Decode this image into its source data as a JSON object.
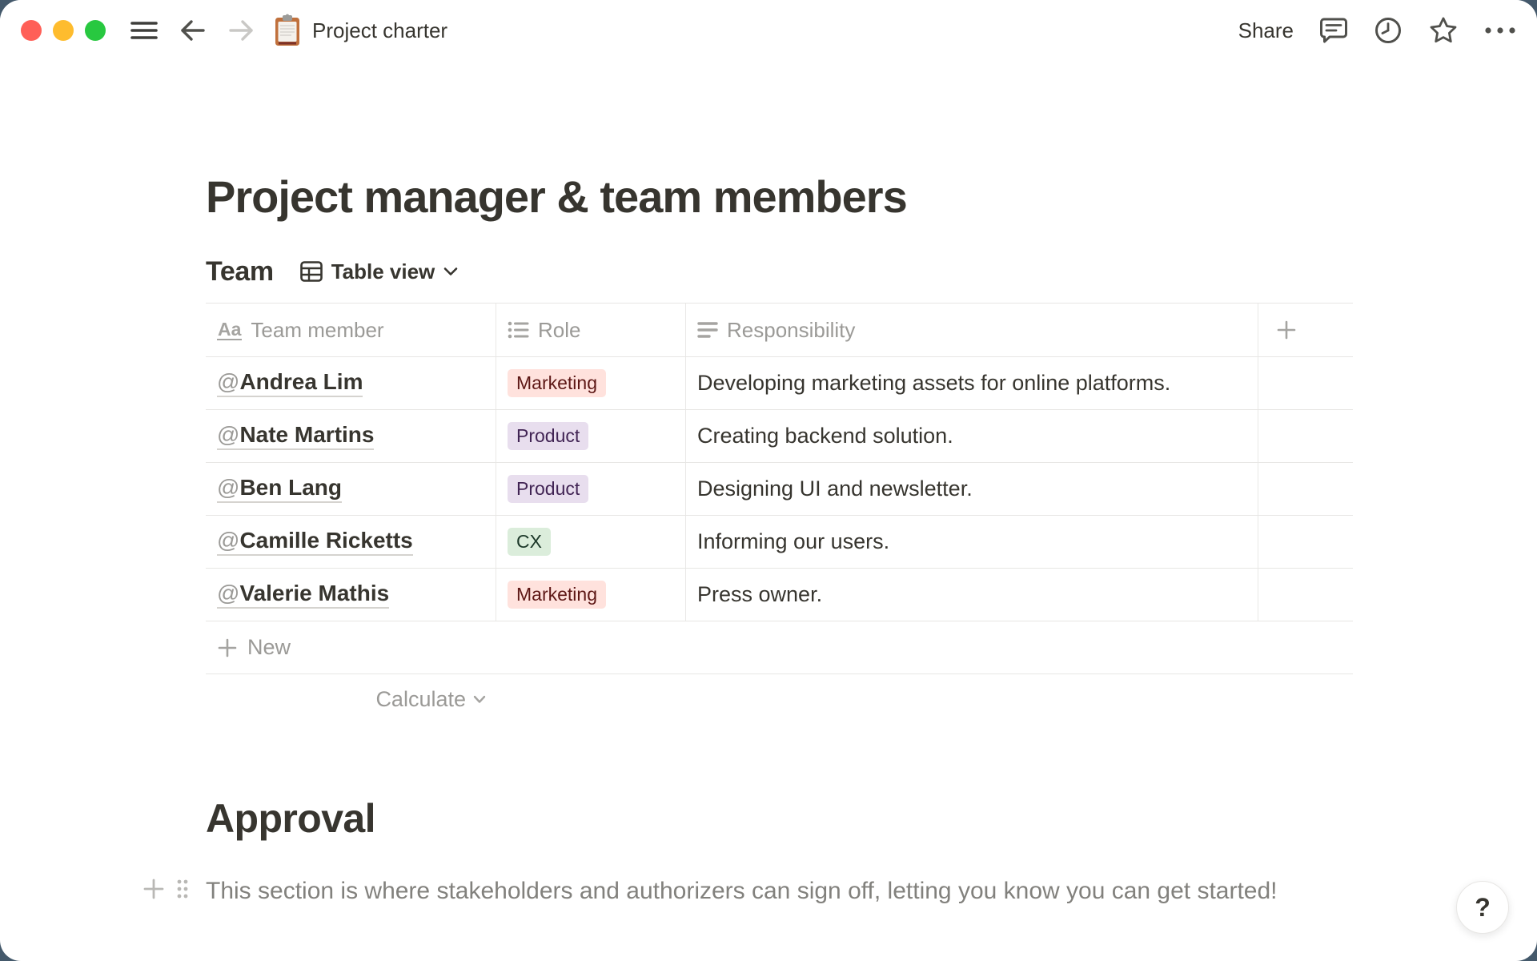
{
  "window": {
    "backdrop_color": "#44596B"
  },
  "topbar": {
    "traffic_lights": {
      "close": "#FF5F57",
      "minimize": "#FEBC2E",
      "zoom": "#28C840"
    },
    "doc_icon": "clipboard",
    "doc_title": "Project charter",
    "share_label": "Share"
  },
  "page": {
    "title": "Project manager & team members",
    "team": {
      "heading": "Team",
      "view_label": "Table view",
      "table": {
        "columns": [
          {
            "label": "Team member",
            "icon": "title-property"
          },
          {
            "label": "Role",
            "icon": "select-property"
          },
          {
            "label": "Responsibility",
            "icon": "text-property"
          }
        ],
        "rows": [
          {
            "member_at": "@",
            "member_name": "Andrea Lim",
            "role": "Marketing",
            "role_bg": "#FFE2DD",
            "role_fg": "#5D1715",
            "responsibility": "Developing marketing assets for online platforms."
          },
          {
            "member_at": "@",
            "member_name": "Nate Martins",
            "role": "Product",
            "role_bg": "#E8DEEE",
            "role_fg": "#412454",
            "responsibility": "Creating backend solution."
          },
          {
            "member_at": "@",
            "member_name": "Ben Lang",
            "role": "Product",
            "role_bg": "#E8DEEE",
            "role_fg": "#412454",
            "responsibility": "Designing UI and newsletter."
          },
          {
            "member_at": "@",
            "member_name": "Camille Ricketts",
            "role": "CX",
            "role_bg": "#DBEDDB",
            "role_fg": "#1C3829",
            "responsibility": "Informing our users."
          },
          {
            "member_at": "@",
            "member_name": "Valerie Mathis",
            "role": "Marketing",
            "role_bg": "#FFE2DD",
            "role_fg": "#5D1715",
            "responsibility": "Press owner."
          }
        ],
        "new_label": "New",
        "calculate_label": "Calculate"
      }
    },
    "approval": {
      "heading": "Approval",
      "paragraph": "This section is where stakeholders and authorizers can sign off, letting you know you can get started!"
    }
  },
  "help": {
    "label": "?"
  }
}
